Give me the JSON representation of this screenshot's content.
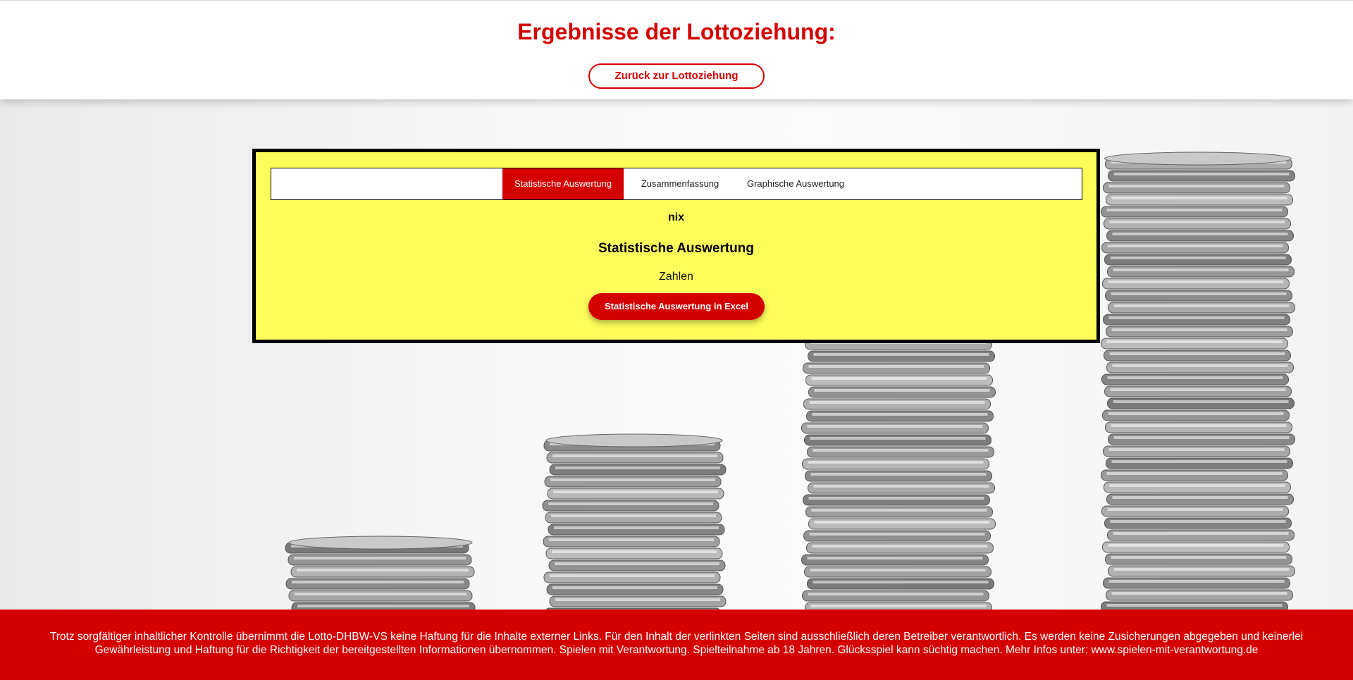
{
  "header": {
    "title": "Ergebnisse der Lottoziehung:",
    "back_button": "Zurück zur Lottoziehung"
  },
  "tabs": [
    {
      "label": "Statistische Auswertung",
      "active": true
    },
    {
      "label": "Zusammenfassung",
      "active": false
    },
    {
      "label": "Graphische Auswertung",
      "active": false
    }
  ],
  "panel": {
    "nix_text": "nix",
    "section_title": "Statistische Auswertung",
    "zahlen_label": "Zahlen",
    "excel_button": "Statistische Auswertung in Excel"
  },
  "footer": {
    "disclaimer": "Trotz sorgfältiger inhaltlicher Kontrolle übernimmt die Lotto-DHBW-VS keine Haftung für die Inhalte externer Links. Für den Inhalt der verlinkten Seiten sind ausschließlich deren Betreiber verantwortlich. Es werden keine Zusicherungen abgegeben und keinerlei Gewährleistung und Haftung für die Richtigkeit der bereitgestellten Informationen übernommen. Spielen mit Verantwortung. Spielteilnahme ab 18 Jahren. Glücksspiel kann süchtig machen. Mehr Infos unter:",
    "link": "www.spielen-mit-verantwortung.de"
  },
  "colors": {
    "brand_red": "#d40000",
    "panel_yellow": "#fcfc5b"
  }
}
